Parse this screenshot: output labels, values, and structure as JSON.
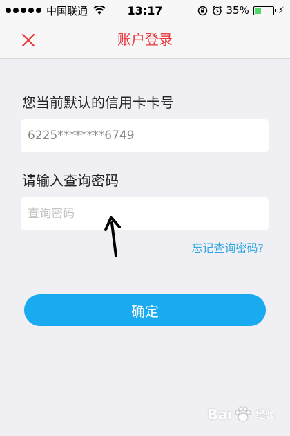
{
  "status_bar": {
    "carrier": "中国联通",
    "time": "13:17",
    "battery_percent": "35%",
    "battery_level": 0.35
  },
  "nav": {
    "title": "账户登录",
    "close_icon": "close-x-icon",
    "accent_color": "#e8363c"
  },
  "form": {
    "card_label": "您当前默认的信用卡卡号",
    "card_number": "6225********6749",
    "password_label": "请输入查询密码",
    "password_placeholder": "查询密码",
    "forgot_link": "忘记查询密码?",
    "confirm_button": "确定",
    "button_color": "#19aaf0"
  },
  "watermark": {
    "brand": "Bai",
    "brand_tail": "经验",
    "icon": "baidu-paw-icon"
  }
}
